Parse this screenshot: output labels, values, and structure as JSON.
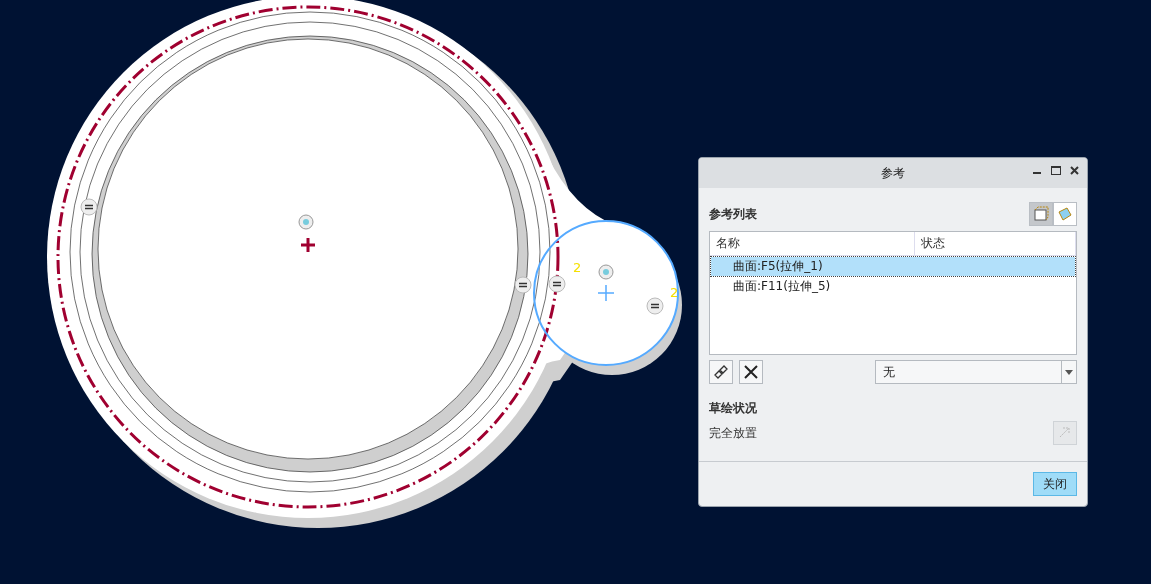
{
  "canvas": {
    "constraint_labels": [
      "2",
      "2"
    ]
  },
  "dialog": {
    "title": "参考",
    "section_title": "参考列表",
    "view_toggles": [
      {
        "selected": true
      },
      {
        "selected": false
      }
    ],
    "table": {
      "columns": [
        "名称",
        "状态"
      ],
      "rows": [
        {
          "name": "曲面:F5(拉伸_1)",
          "selected": true
        },
        {
          "name": "曲面:F11(拉伸_5)",
          "selected": false
        }
      ]
    },
    "filter": {
      "value": "无"
    },
    "status_title": "草绘状况",
    "status_text": "完全放置",
    "close_button": "关闭"
  }
}
